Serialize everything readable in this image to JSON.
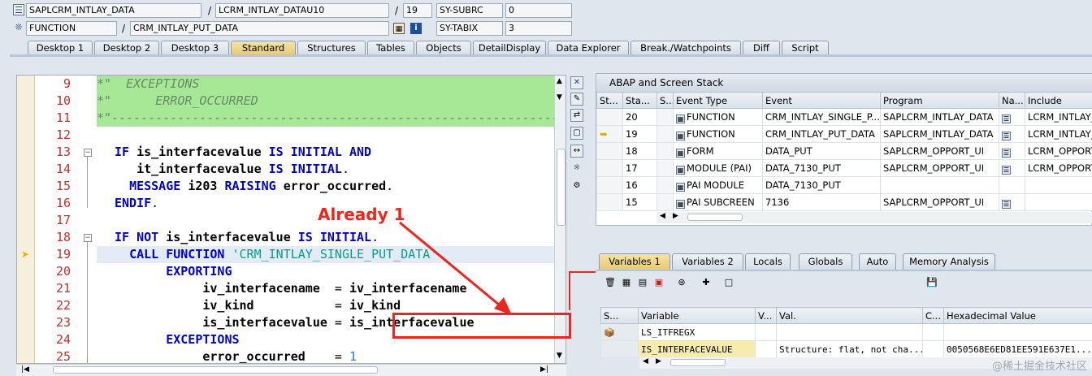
{
  "header": {
    "row1": {
      "program": "SAPLCRM_INTLAY_DATA",
      "include": "LCRM_INTLAY_DATAU10",
      "line": "19",
      "sysvar": "SY-SUBRC",
      "sysval": "0"
    },
    "row2": {
      "type": "FUNCTION",
      "name": "CRM_INTLAY_PUT_DATA",
      "sysvar": "SY-TABIX",
      "sysval": "3"
    }
  },
  "tabs": [
    "Desktop 1",
    "Desktop 2",
    "Desktop 3",
    "Standard",
    "Structures",
    "Tables",
    "Objects",
    "DetailDisplay",
    "Data Explorer",
    "Break./Watchpoints",
    "Diff",
    "Script"
  ],
  "active_tab": "Standard",
  "code": {
    "lines": [
      {
        "n": "9",
        "text": "*\"  EXCEPTIONS"
      },
      {
        "n": "10",
        "text": "*\"      ERROR_OCCURRED"
      },
      {
        "n": "11",
        "text": "*\"----------------------------------------------------------------------"
      },
      {
        "n": "12",
        "text": ""
      },
      {
        "n": "13",
        "text": "IF is_interfacevalue IS INITIAL AND"
      },
      {
        "n": "14",
        "text": "   it_interfacevalue IS INITIAL."
      },
      {
        "n": "15",
        "text": "  MESSAGE i203 RAISING error_occurred."
      },
      {
        "n": "16",
        "text": "ENDIF."
      },
      {
        "n": "17",
        "text": ""
      },
      {
        "n": "18",
        "text": "IF NOT is_interfacevalue IS INITIAL."
      },
      {
        "n": "19",
        "text": "  CALL FUNCTION 'CRM_INTLAY_SINGLE_PUT_DATA'"
      },
      {
        "n": "20",
        "text": "       EXPORTING"
      },
      {
        "n": "21",
        "text": "            iv_interfacename  = iv_interfacename"
      },
      {
        "n": "22",
        "text": "            iv_kind           = iv_kind"
      },
      {
        "n": "23",
        "text": "            is_interfacevalue = is_interfacevalue"
      },
      {
        "n": "24",
        "text": "       EXCEPTIONS"
      },
      {
        "n": "25",
        "text": "            error_occurred    = 1"
      }
    ]
  },
  "annotation": {
    "label": "Already 1",
    "color": "#e8271e"
  },
  "stack": {
    "title": "ABAP and Screen Stack",
    "columns": [
      "St...",
      "Sta...",
      "S...",
      "Event Type",
      "Event",
      "Program",
      "Na...",
      "Include"
    ],
    "rows": [
      {
        "level": "20",
        "type": "FUNCTION",
        "event": "CRM_INTLAY_SINGLE_P...",
        "program": "SAPLCRM_INTLAY_DATA",
        "include": "LCRM_INTLAY_",
        "current": false
      },
      {
        "level": "19",
        "type": "FUNCTION",
        "event": "CRM_INTLAY_PUT_DATA",
        "program": "SAPLCRM_INTLAY_DATA",
        "include": "LCRM_INTLAY_",
        "current": true
      },
      {
        "level": "18",
        "type": "FORM",
        "event": "DATA_PUT",
        "program": "SAPLCRM_OPPORT_UI",
        "include": "LCRM_OPPORT_",
        "current": false
      },
      {
        "level": "17",
        "type": "MODULE (PAI)",
        "event": "DATA_7130_PUT",
        "program": "SAPLCRM_OPPORT_UI",
        "include": "LCRM_OPPORT_",
        "current": false
      },
      {
        "level": "16",
        "type": "PAI MODULE",
        "event": "DATA_7130_PUT",
        "program": "",
        "include": "",
        "current": false
      },
      {
        "level": "15",
        "type": "PAI SUBCREEN",
        "event": "7136",
        "program": "SAPLCRM_OPPORT_UI",
        "include": "",
        "current": false
      }
    ]
  },
  "vartabs": [
    "Variables 1",
    "Variables 2",
    "Locals",
    "Globals",
    "Auto",
    "Memory Analysis"
  ],
  "vars": {
    "columns": [
      "S...",
      "Variable",
      "V...",
      "Val.",
      "C...",
      "Hexadecimal Value"
    ],
    "rows": [
      {
        "name": "LS_ITFREGX",
        "val": "",
        "hex": ""
      },
      {
        "name": "IS_INTERFACEVALUE",
        "val": "Structure: flat, not cha...",
        "hex": "0050568E6ED81EE591E637E1..."
      }
    ]
  },
  "watermark": "@稀土掘金技术社区"
}
